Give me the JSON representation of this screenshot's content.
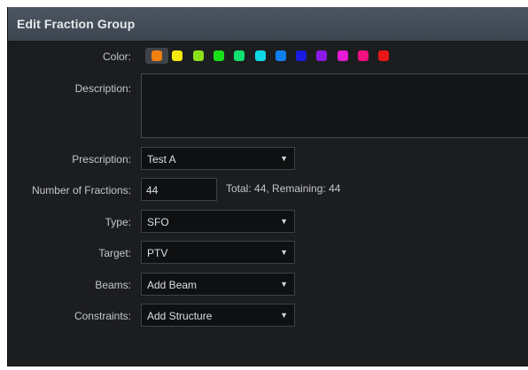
{
  "dialog": {
    "title": "Edit Fraction Group"
  },
  "labels": {
    "color": "Color:",
    "description": "Description:",
    "prescription": "Prescription:",
    "number_of_fractions": "Number of Fractions:",
    "type": "Type:",
    "target": "Target:",
    "beams": "Beams:",
    "constraints": "Constraints:"
  },
  "colors": [
    "#f08010",
    "#f5e80a",
    "#8ce01a",
    "#18e018",
    "#10e070",
    "#10d8e8",
    "#1080f0",
    "#1a1ae0",
    "#8a1ae8",
    "#e81ad8",
    "#f01080",
    "#e81818"
  ],
  "selected_color": "#f08010",
  "description": {
    "value": ""
  },
  "prescription": {
    "value": "Test A"
  },
  "number_of_fractions": {
    "value": "44",
    "summary": "Total: 44, Remaining: 44"
  },
  "type": {
    "value": "SFO"
  },
  "target": {
    "value": "PTV"
  },
  "beams": {
    "value": "Add Beam"
  },
  "constraints": {
    "value": "Add Structure"
  }
}
